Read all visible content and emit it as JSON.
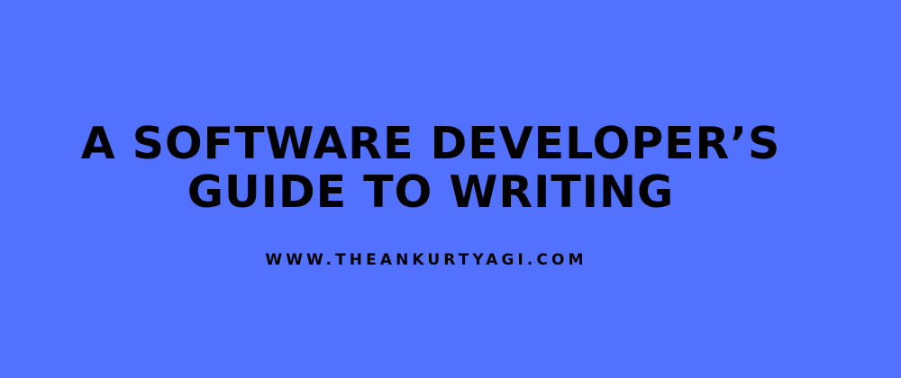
{
  "banner": {
    "background_color": "#5271ff",
    "text_color": "#000000",
    "title": {
      "line1": "A SOFTWARE DEVELOPER’S",
      "line2": "GUIDE TO WRITING"
    },
    "website": "WWW.THEANKURTYAGI.COM"
  }
}
